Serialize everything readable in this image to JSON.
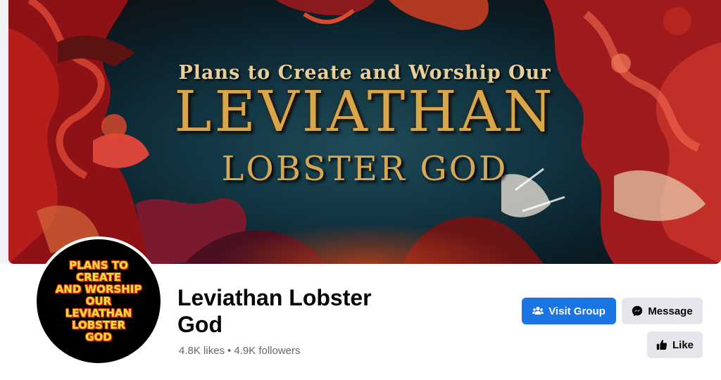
{
  "cover": {
    "subtitle": "Plans to Create and Worship Our",
    "title_main": "LEVIATHAN",
    "title_sub": "LOBSTER GOD"
  },
  "avatar": {
    "lines": [
      "PLANS TO",
      "CREATE",
      "AND WORSHIP",
      "OUR",
      "LEVIATHAN",
      "LOBSTER",
      "GOD"
    ]
  },
  "profile": {
    "name": "Leviathan Lobster God",
    "likes": "4.8K likes",
    "separator": "•",
    "followers": "4.9K followers"
  },
  "actions": {
    "visit_group": "Visit Group",
    "message": "Message",
    "like": "Like"
  },
  "colors": {
    "primary": "#1b74e4",
    "secondary": "#e4e6eb",
    "text": "#050505",
    "muted": "#65676b",
    "cover_gold": "#d9a64a",
    "cover_red": "#b0171a"
  },
  "icons": {
    "visit_group": "people-icon",
    "message": "messenger-icon",
    "like": "thumbs-up-icon"
  }
}
